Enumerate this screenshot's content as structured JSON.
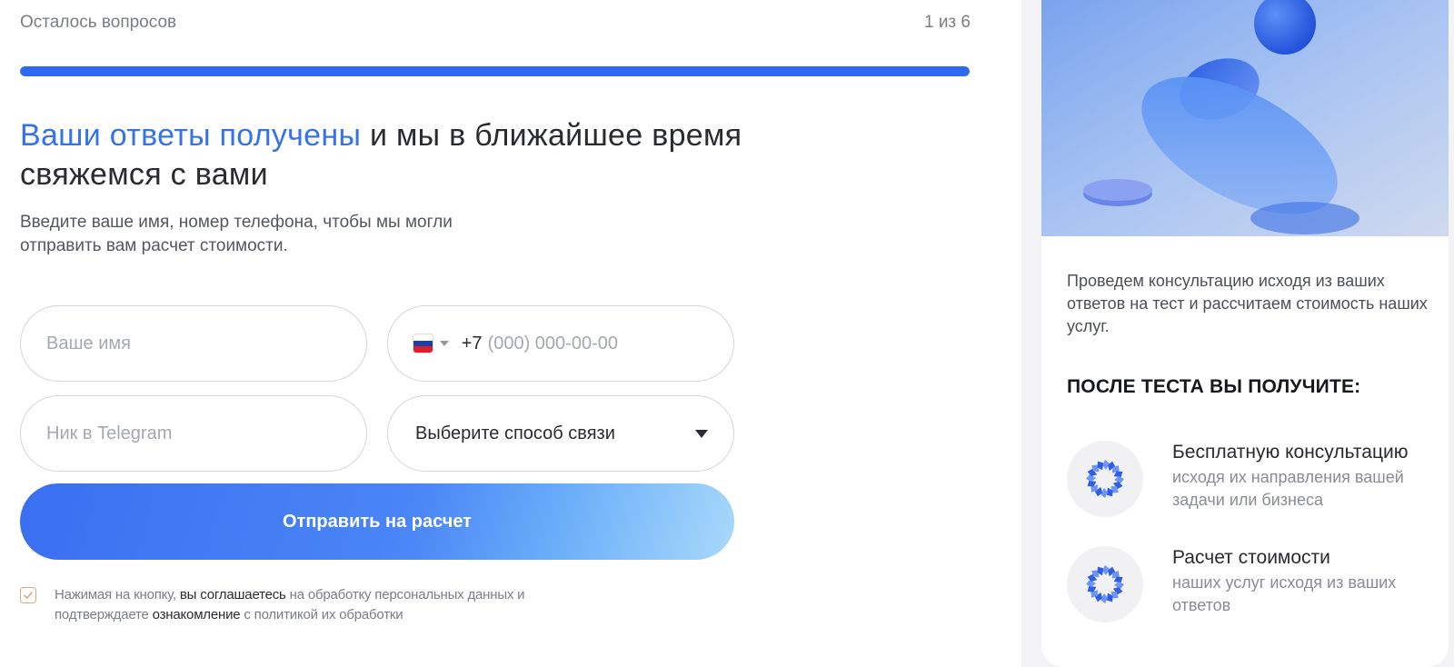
{
  "progress": {
    "label": "Осталось вопросов",
    "counter": "1 из 6",
    "fraction": 1.0,
    "color": "#2f69ee"
  },
  "heading": {
    "accent": "Ваши ответы получены",
    "rest": " и мы в ближайшее время свяжемся с вами",
    "accent_color": "#3573e8"
  },
  "subtitle": "Введите ваше имя, номер телефона, чтобы мы могли отправить вам расчет стоимости.",
  "form": {
    "name_placeholder": "Ваше имя",
    "phone_prefix": "+7",
    "phone_placeholder": "(000) 000-00-00",
    "phone_country_icon": "russia-flag-icon",
    "telegram_placeholder": "Ник в Telegram",
    "contact_method_label": "Выберите способ связи",
    "submit_label": "Отправить на расчет",
    "consent_checked": true,
    "consent_part1": "Нажимая на кнопку, ",
    "consent_part2": "вы соглашаетесь",
    "consent_part3": " на обработку персональных данных и подтверждаете ",
    "consent_part4": "ознакомление",
    "consent_part5": " с политикой их обработки"
  },
  "sidebar": {
    "hero_icon": "abstract-3d-shapes-illustration",
    "intro": "Проведем консультацию исходя из ваших ответов на тест и рассчитаем стоимость наших услуг.",
    "benefits_title": "ПОСЛЕ ТЕСТА ВЫ ПОЛУЧИТЕ:",
    "benefits": [
      {
        "icon": "spiral-ring-icon",
        "title": "Бесплатную консультацию",
        "desc": "исходя их направления вашей задачи или бизнеса"
      },
      {
        "icon": "spiral-ring-icon",
        "title": "Расчет стоимости",
        "desc": "наших услуг исходя из ваших ответов"
      }
    ]
  }
}
